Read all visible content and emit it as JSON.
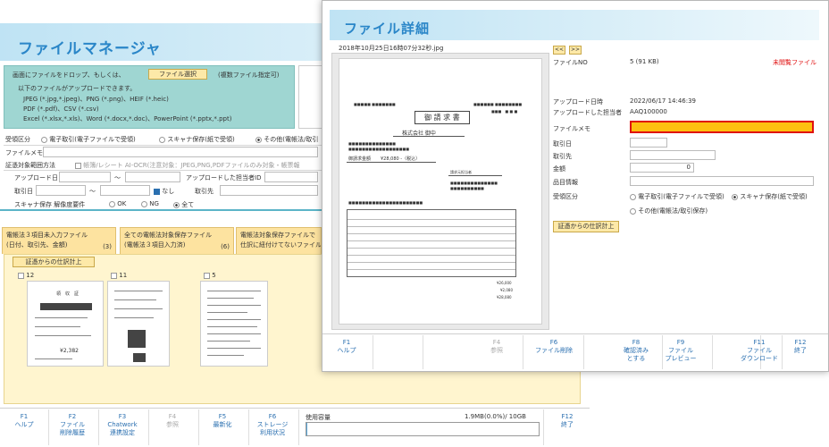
{
  "file_manager": {
    "title": "ファイルマネージャ",
    "drop": {
      "line1": "画面にファイルをドロップ、もしくは、",
      "file_select_button": "ファイル選択",
      "multi_note": "(複数ファイル指定可)",
      "line2": "以下のファイルがアップロードできます。",
      "line3": "JPEG (*.jpg,*.jpeg)、PNG (*.png)、HEIF (*.heic)",
      "line4": "PDF (*.pdf)、CSV (*.csv)",
      "line5": "Excel (*.xlsx,*.xls)、Word (*.docx,*.doc)、PowerPoint (*.pptx,*.ppt)"
    },
    "receive_type": {
      "label": "受領区分",
      "opt1": "電子取引(電子ファイルで受領)",
      "opt2": "スキャナ保存(紙で受領)",
      "opt3": "その他(電帳法/取引"
    },
    "file_memo_label": "ファイルメモ",
    "evidence_label": "証憑対象範囲方法",
    "ocr_text": "帳簿/レシート AI-OCR(注意対象：JPEG,PNG,PDFファイルのみ対象・帳票報",
    "upload_date_label": "アップロード日",
    "tilde1": "〜",
    "uploader_label": "アップロードした担当者ID",
    "trade_date_label": "取引日",
    "tilde2": "〜",
    "none_label": "なし",
    "partner_label": "取引先",
    "scanner_label": "スキャナ保存 解像度要件",
    "ok_label": "OK",
    "ng_label": "NG",
    "all_label": "全て",
    "tabs": [
      {
        "line1": "電帳法３項目未入力ファイル",
        "line2": "(日付、取引先、金額)",
        "count": "(3)"
      },
      {
        "line1": "全ての電帳法対象保存ファイル",
        "line2": "(電帳法３項目入力済)",
        "count": "(6)"
      },
      {
        "line1": "電帳法対象保存ファイルで",
        "line2": "仕訳に紐付けてないファイル",
        "count": ""
      }
    ],
    "evidence_button": "証憑からの仕訳計上",
    "thumbs": [
      {
        "count": "12"
      },
      {
        "count": "11"
      },
      {
        "count": "5"
      }
    ],
    "thumb1_title": "領　収　証",
    "thumb1_total": "¥2,382",
    "footer": [
      {
        "key": "F1",
        "label": "ヘルプ",
        "label2": ""
      },
      {
        "key": "F2",
        "label": "ファイル",
        "label2": "削除履歴"
      },
      {
        "key": "F3",
        "label": "Chatwork",
        "label2": "連携設定"
      },
      {
        "key": "F4",
        "label": "参照",
        "label2": ""
      },
      {
        "key": "F5",
        "label": "最新化",
        "label2": ""
      },
      {
        "key": "F6",
        "label": "ストレージ",
        "label2": "利用状況"
      },
      {
        "key": "F12",
        "label": "終了",
        "label2": ""
      }
    ],
    "usage": {
      "label": "使用容量",
      "value": "1.9MB(0.0%)/ 10GB",
      "fraction": 0.001
    }
  },
  "file_detail": {
    "title": "ファイル詳細",
    "filename": "2018年10月25日16時07分32秒.jpg",
    "nav_prev": "<<",
    "nav_next": ">>",
    "file_no_label": "ファイルNO",
    "file_no_value": "5 (91 KB)",
    "unconfirmed": "未閲覧ファイル",
    "upload_date_label": "アップロード日時",
    "upload_date_value": "2022/06/17 14:46:39",
    "uploader_label": "アップロードした担当者",
    "uploader_value": "AAQ100000",
    "memo_label": "ファイルメモ",
    "trade_date_label": "取引日",
    "partner_label": "取引先",
    "amount_label": "金額",
    "amount_value": "0",
    "item_label": "品目情報",
    "receive_label": "受領区分",
    "receive_opt1": "電子取引(電子ファイルで受領)",
    "receive_opt2": "スキャナ保存(紙で受領)",
    "receive_opt3": "その他(電帳法/取引保存)",
    "evidence_button": "証憑からの仕訳計上",
    "doc": {
      "title": "御 請 求 書",
      "company": "株式会社 御中",
      "total_label": "御請求金額",
      "total_value": "¥28,080 -（税込）",
      "issuer": "請求元担当者",
      "subtotal_row": "¥26,000",
      "tax_row": "¥2,080",
      "total_row": "¥28,080"
    },
    "footer": [
      {
        "key": "F1",
        "label": "ヘルプ",
        "label2": ""
      },
      {
        "key": "F4",
        "label": "参照",
        "label2": ""
      },
      {
        "key": "F6",
        "label": "ファイル削除",
        "label2": ""
      },
      {
        "key": "F8",
        "label": "確認済み",
        "label2": "とする"
      },
      {
        "key": "F9",
        "label": "ファイル",
        "label2": "プレビュー"
      },
      {
        "key": "F11",
        "label": "ファイル",
        "label2": "ダウンロード"
      },
      {
        "key": "F12",
        "label": "終了",
        "label2": ""
      }
    ]
  },
  "colors": {
    "accent": "#2a86c8",
    "drop_area": "#9fd6d2",
    "button": "#fde9a8",
    "memo_highlight": "#fdc010",
    "alert": "#e01010"
  }
}
